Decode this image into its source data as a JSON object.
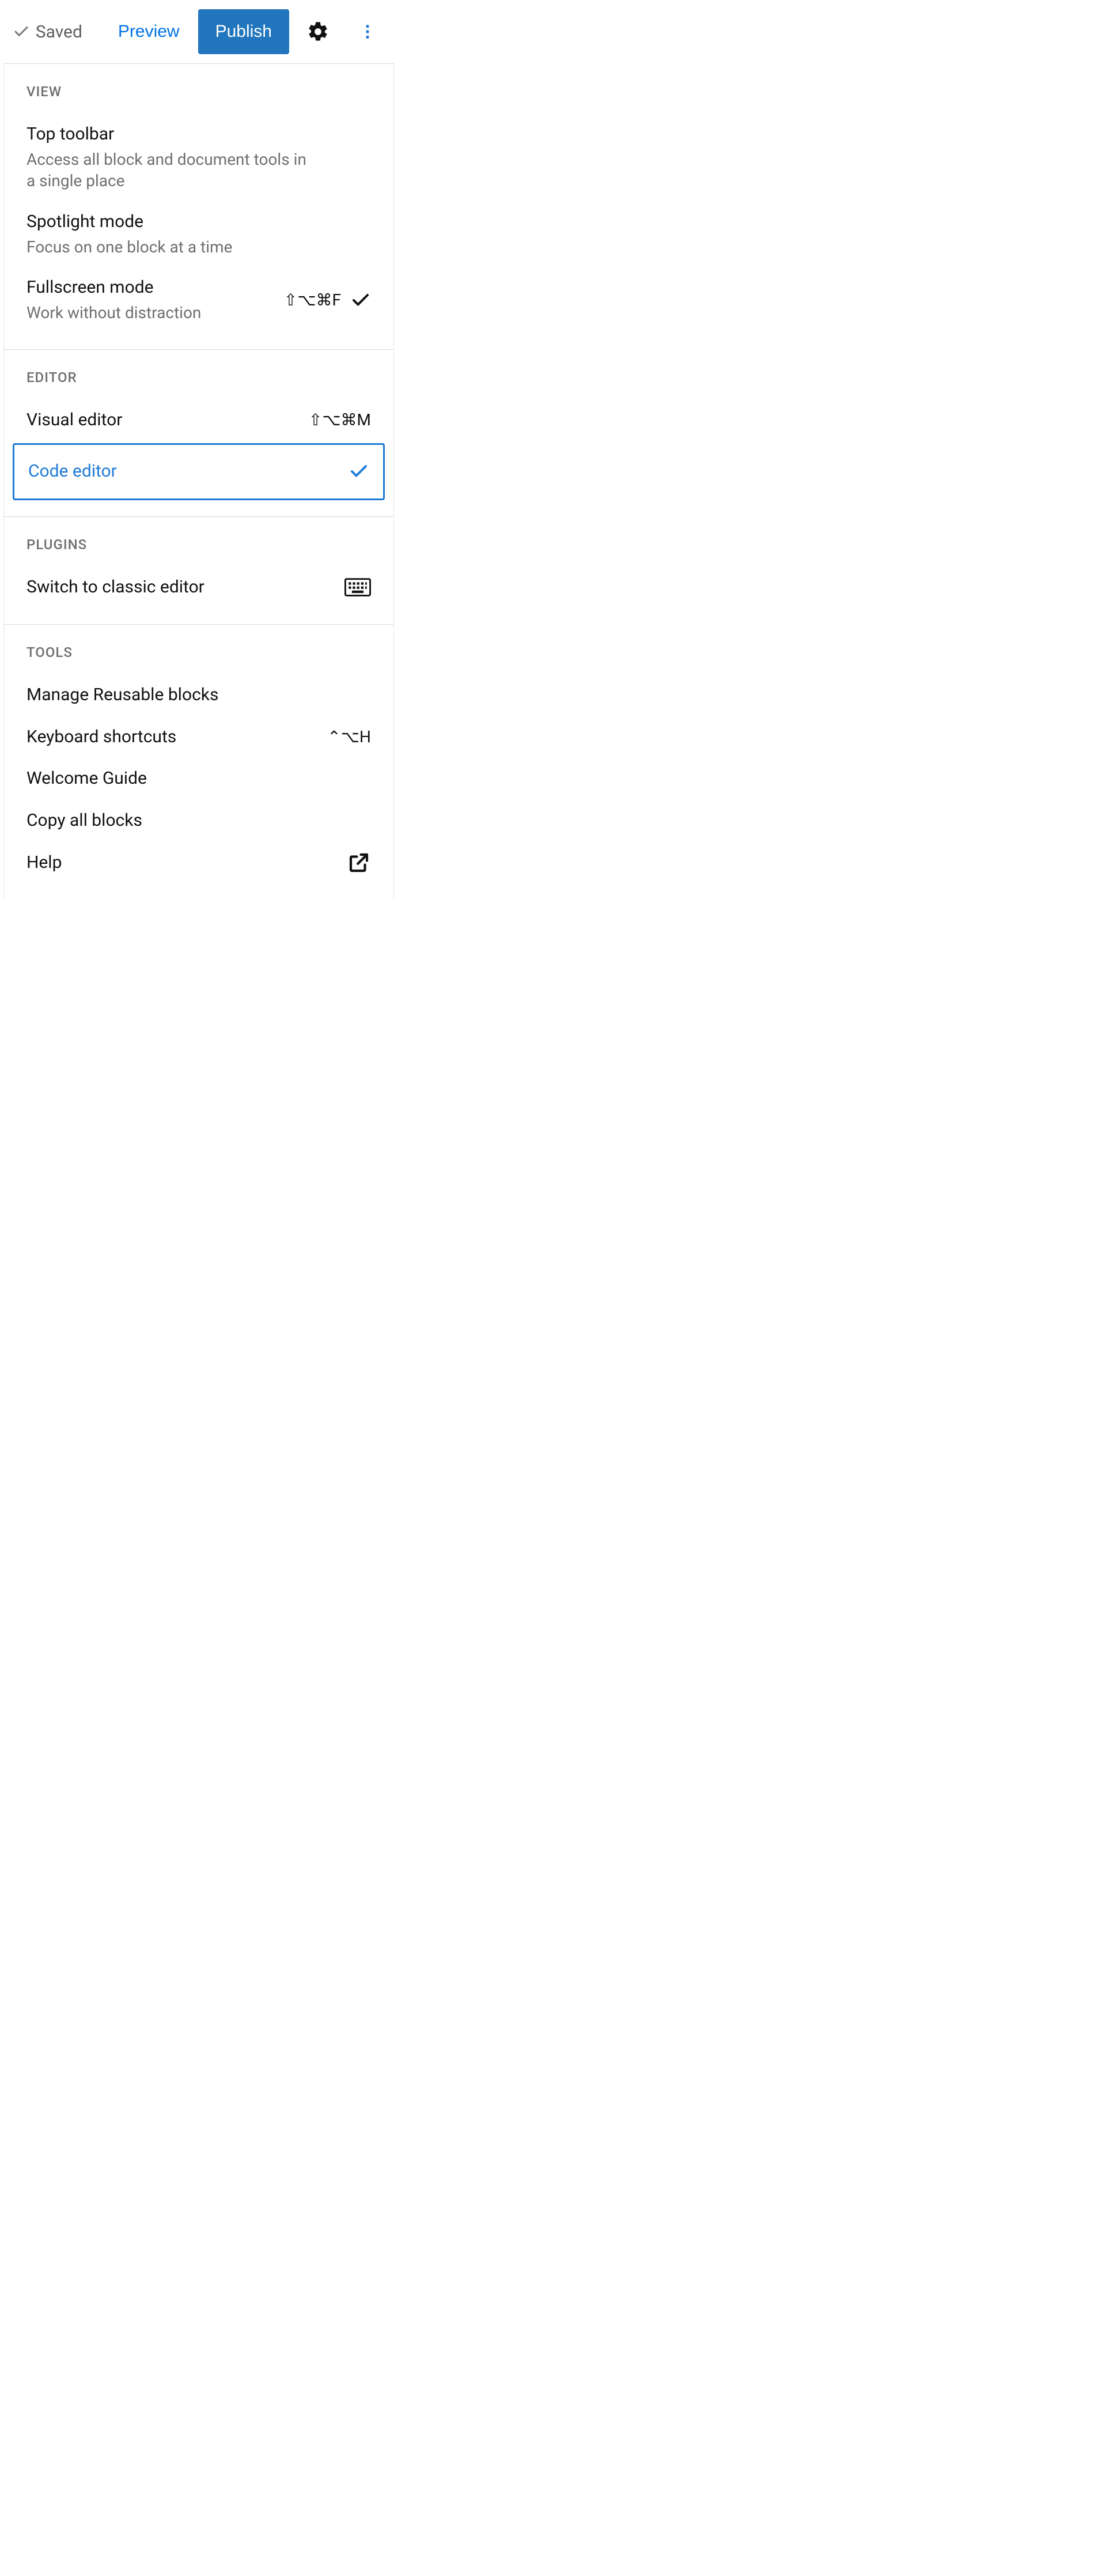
{
  "header": {
    "saved_label": "Saved",
    "preview_label": "Preview",
    "publish_label": "Publish"
  },
  "sections": {
    "view": {
      "label": "VIEW",
      "top_toolbar": {
        "title": "Top toolbar",
        "desc": "Access all block and document tools in a single place"
      },
      "spotlight": {
        "title": "Spotlight mode",
        "desc": "Focus on one block at a time"
      },
      "fullscreen": {
        "title": "Fullscreen mode",
        "desc": "Work without distraction",
        "shortcut": "⇧⌥⌘F"
      }
    },
    "editor": {
      "label": "EDITOR",
      "visual": {
        "title": "Visual editor",
        "shortcut": "⇧⌥⌘M"
      },
      "code": {
        "title": "Code editor"
      }
    },
    "plugins": {
      "label": "PLUGINS",
      "classic": {
        "title": "Switch to classic editor"
      }
    },
    "tools": {
      "label": "TOOLS",
      "reusable": {
        "title": "Manage Reusable blocks"
      },
      "shortcuts": {
        "title": "Keyboard shortcuts",
        "shortcut": "⌃⌥H"
      },
      "welcome": {
        "title": "Welcome Guide"
      },
      "copy": {
        "title": "Copy all blocks"
      },
      "help": {
        "title": "Help"
      }
    }
  }
}
